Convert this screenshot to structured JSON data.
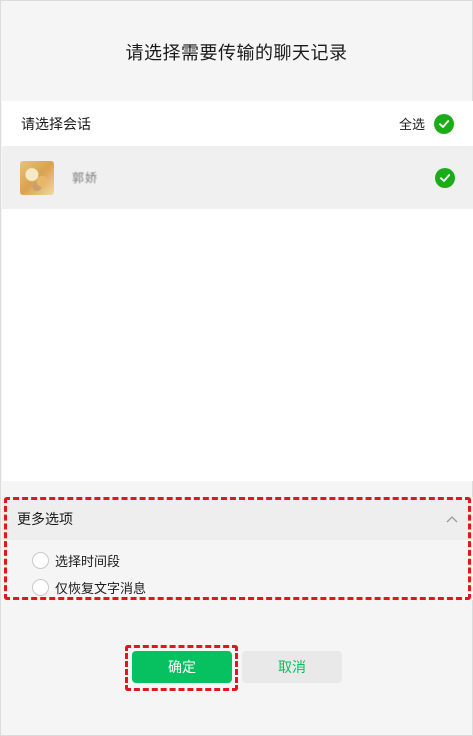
{
  "dialog": {
    "title": "请选择需要传输的聊天记录"
  },
  "list": {
    "header_label": "请选择会话",
    "select_all_label": "全选",
    "contacts": [
      {
        "name": "郭娇"
      }
    ]
  },
  "options": {
    "header_label": "更多选项",
    "items": [
      {
        "label": "选择时间段"
      },
      {
        "label": "仅恢复文字消息"
      }
    ]
  },
  "buttons": {
    "confirm_label": "确定",
    "cancel_label": "取消"
  },
  "colors": {
    "accent_green": "#07c160",
    "check_green": "#1aad19",
    "annotation_red": "#e0181d"
  },
  "icons": {
    "check": "check-circle-icon",
    "collapse": "chevron-up-icon",
    "radio": "radio-unchecked-icon",
    "avatar": "contact-avatar"
  }
}
